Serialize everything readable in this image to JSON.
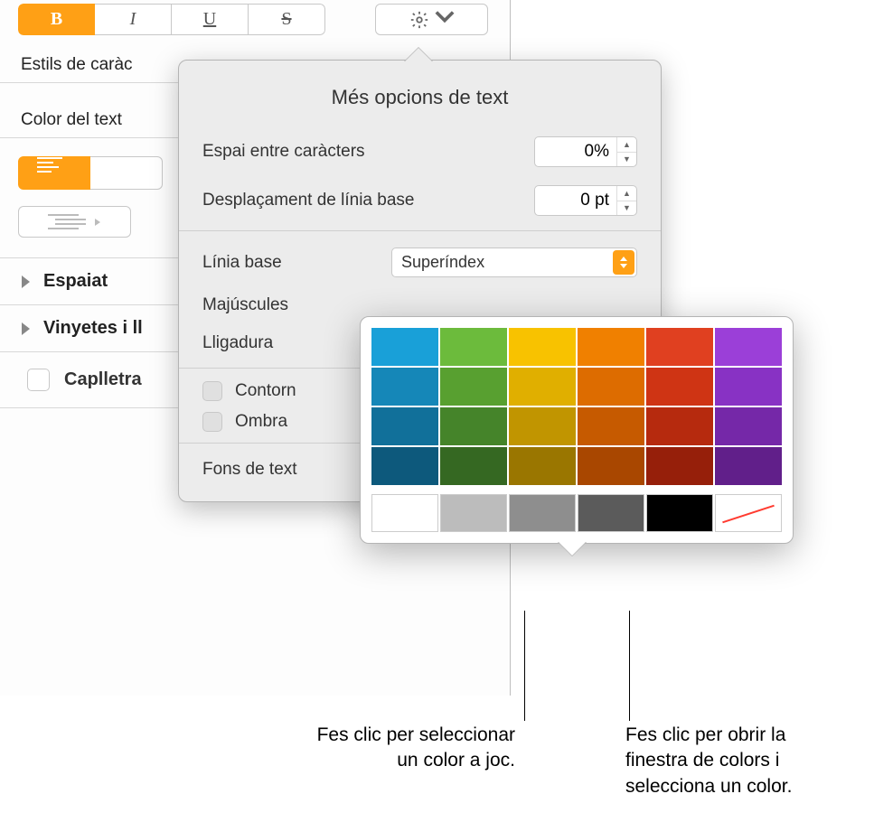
{
  "toolbar": {
    "bold": "B",
    "italic": "I",
    "underline": "U",
    "strike": "S"
  },
  "sidebar": {
    "char_styles_label": "Estils de caràc",
    "text_color_label": "Color del text",
    "spacing_label": "Espaiat",
    "bullets_label": "Vinyetes i ll",
    "dropcap_label": "Caplletra"
  },
  "popover": {
    "title": "Més opcions de text",
    "char_spacing_label": "Espai entre caràcters",
    "char_spacing_value": "0%",
    "baseline_shift_label": "Desplaçament de línia base",
    "baseline_shift_value": "0 pt",
    "baseline_label": "Línia base",
    "baseline_select": "Superíndex",
    "caps_label": "Majúscules",
    "ligature_label": "Lligadura",
    "outline_label": "Contorn",
    "shadow_label": "Ombra",
    "text_bg_label": "Fons de text"
  },
  "palette": {
    "rows": [
      [
        "#19a0d8",
        "#6cbb3c",
        "#f8c200",
        "#f08000",
        "#e04020",
        "#9b3fd8"
      ],
      [
        "#1587b8",
        "#58a030",
        "#e0af00",
        "#dd6c00",
        "#cf3414",
        "#8832c4"
      ],
      [
        "#11709a",
        "#45842a",
        "#c19500",
        "#c65a00",
        "#b62a0e",
        "#7528a8"
      ],
      [
        "#0d597c",
        "#356822",
        "#9a7600",
        "#a94700",
        "#961f0a",
        "#611f8a"
      ]
    ],
    "grays": [
      "#ffffff",
      "#bcbcbc",
      "#8e8e8e",
      "#5b5b5b",
      "#000000"
    ]
  },
  "callouts": {
    "left": "Fes clic per seleccionar un color a joc.",
    "right": "Fes clic per obrir la finestra de colors i selecciona un color."
  }
}
